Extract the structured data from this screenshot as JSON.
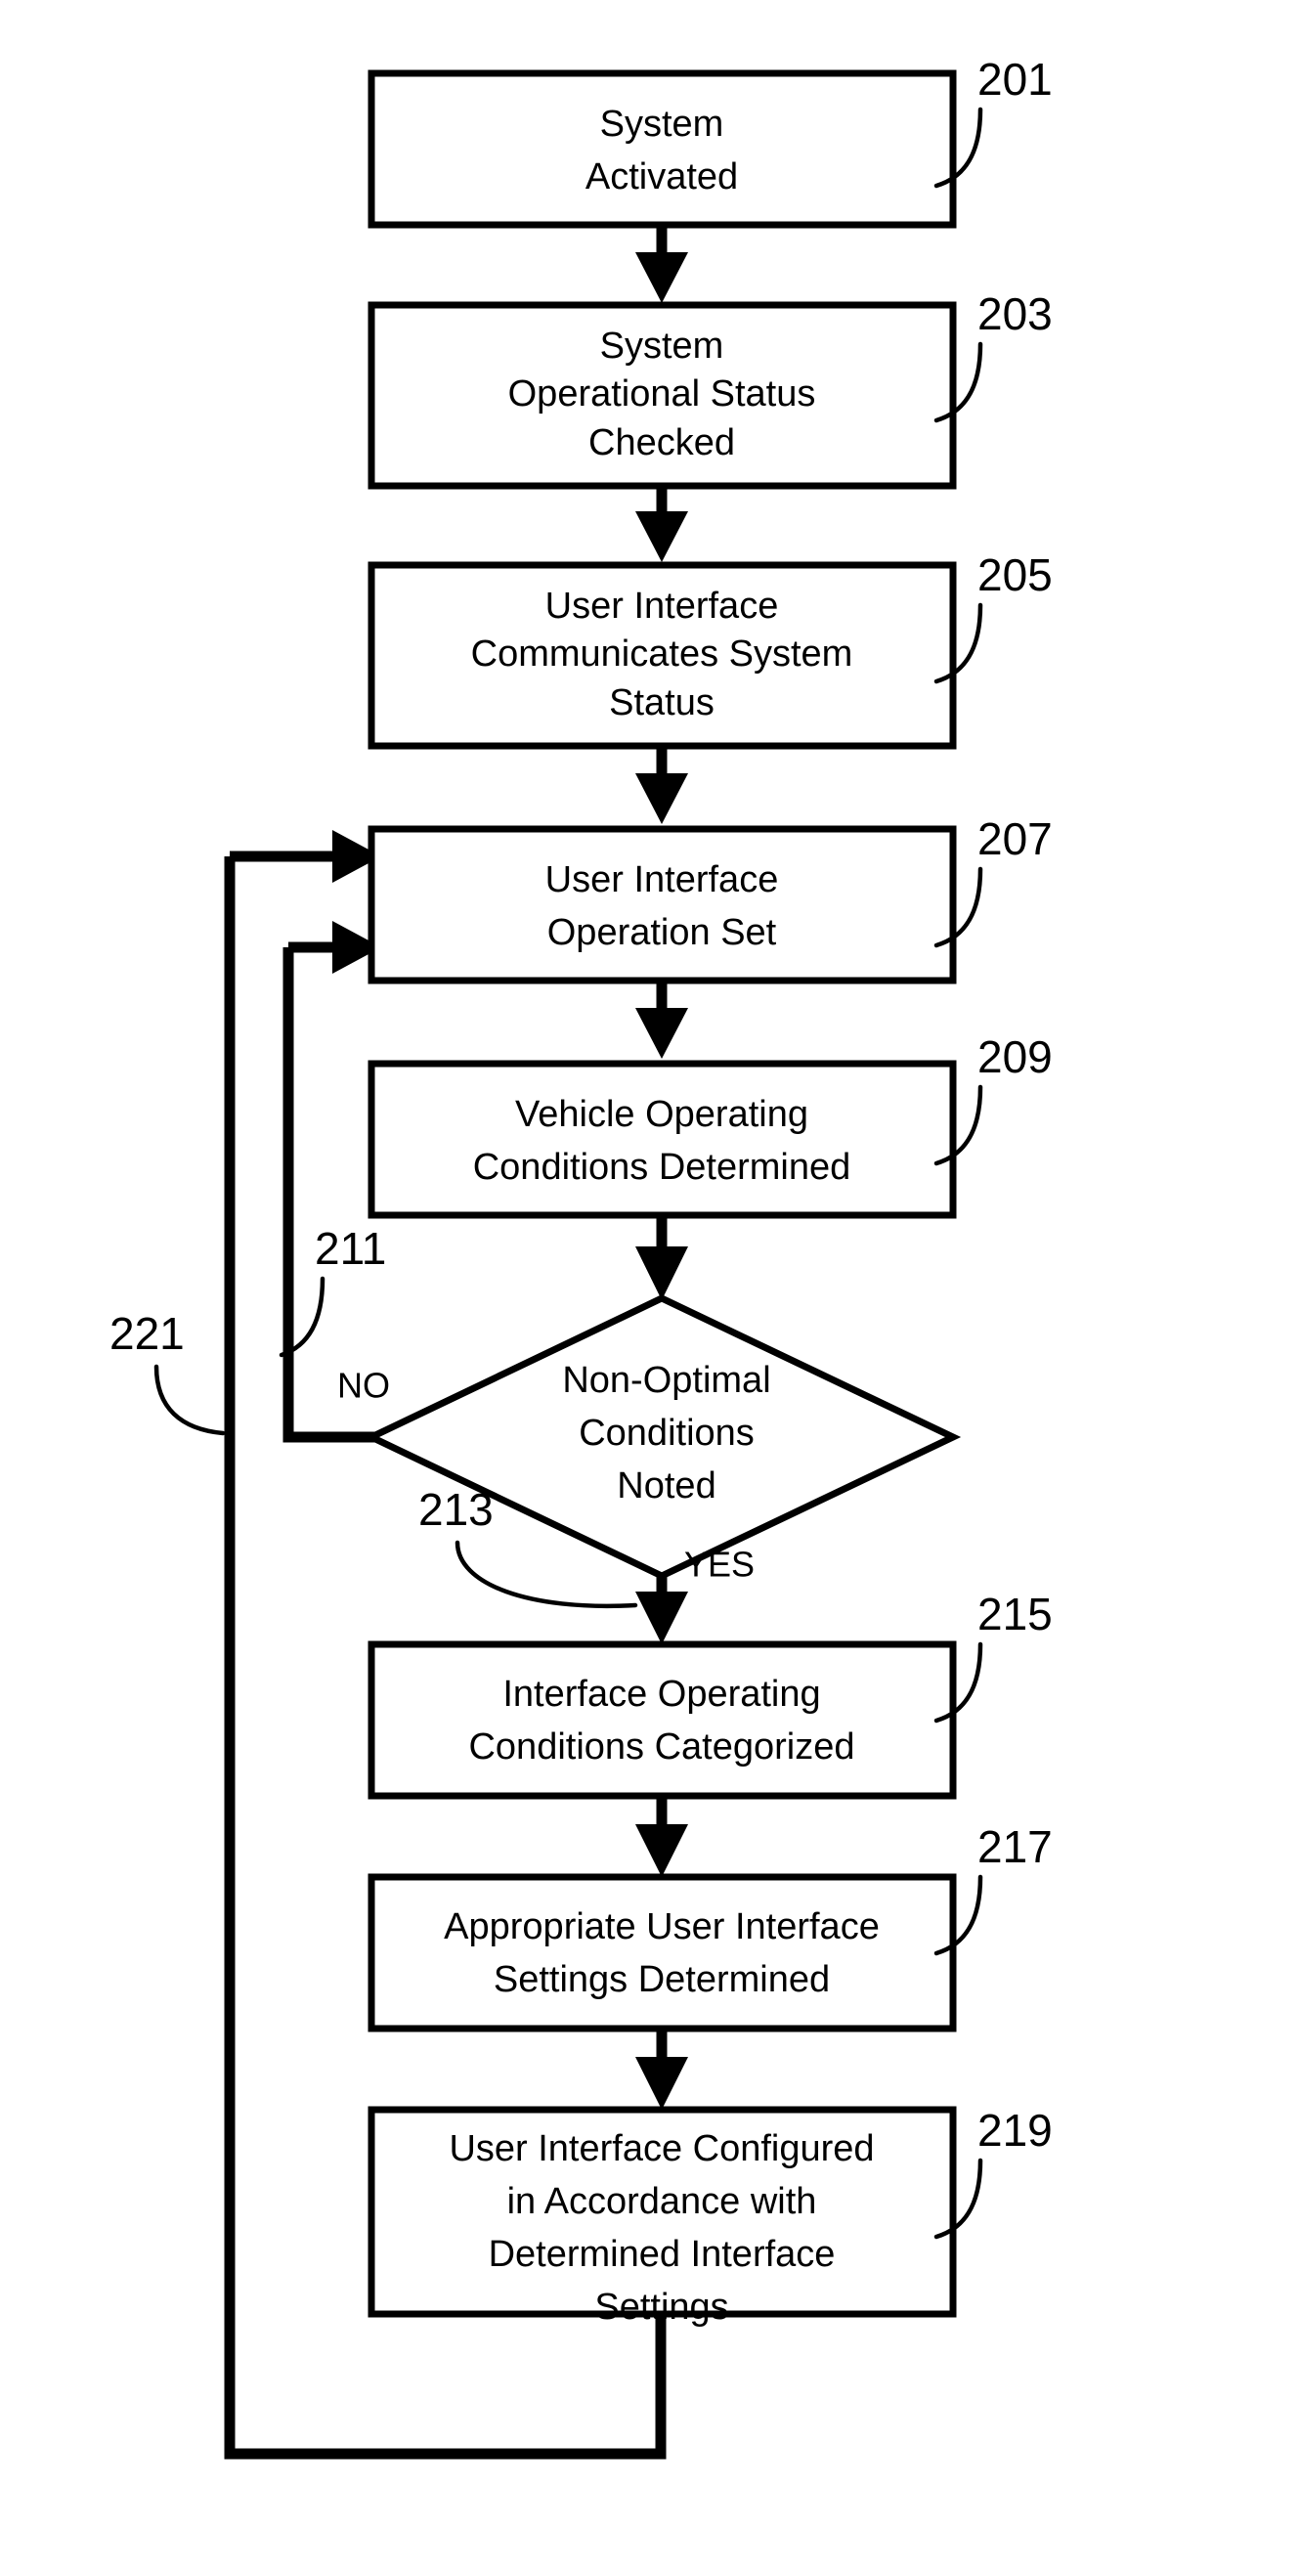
{
  "diagram": {
    "type": "flowchart",
    "title": "",
    "nodes": [
      {
        "id": "201",
        "ref": "201",
        "shape": "rect",
        "lines": [
          "System",
          "Activated"
        ]
      },
      {
        "id": "203",
        "ref": "203",
        "shape": "rect",
        "lines": [
          "System",
          "Operational Status",
          "Checked"
        ]
      },
      {
        "id": "205",
        "ref": "205",
        "shape": "rect",
        "lines": [
          "User Interface",
          "Communicates System",
          "Status"
        ]
      },
      {
        "id": "207",
        "ref": "207",
        "shape": "rect",
        "lines": [
          "User Interface",
          "Operation Set"
        ]
      },
      {
        "id": "209",
        "ref": "209",
        "shape": "rect",
        "lines": [
          "Vehicle Operating",
          "Conditions Determined"
        ]
      },
      {
        "id": "213",
        "ref": "213",
        "shape": "diamond",
        "lines": [
          "Non-Optimal",
          "Conditions",
          "Noted"
        ]
      },
      {
        "id": "215",
        "ref": "215",
        "shape": "rect",
        "lines": [
          "Interface Operating",
          "Conditions Categorized"
        ]
      },
      {
        "id": "217",
        "ref": "217",
        "shape": "rect",
        "lines": [
          "Appropriate User Interface",
          "Settings Determined"
        ]
      },
      {
        "id": "219",
        "ref": "219",
        "shape": "rect",
        "lines": [
          "User Interface Configured",
          "in Accordance with",
          "Determined Interface",
          "Settings"
        ]
      }
    ],
    "branch_labels": {
      "no": "NO",
      "yes": "YES"
    },
    "edge_refs": [
      {
        "ref": "211",
        "describes": "no-branch-feedback"
      },
      {
        "ref": "221",
        "describes": "bottom-feedback-loop"
      }
    ],
    "colors": {
      "stroke": "#000000",
      "fill": "#ffffff",
      "background": "#ffffff"
    }
  }
}
